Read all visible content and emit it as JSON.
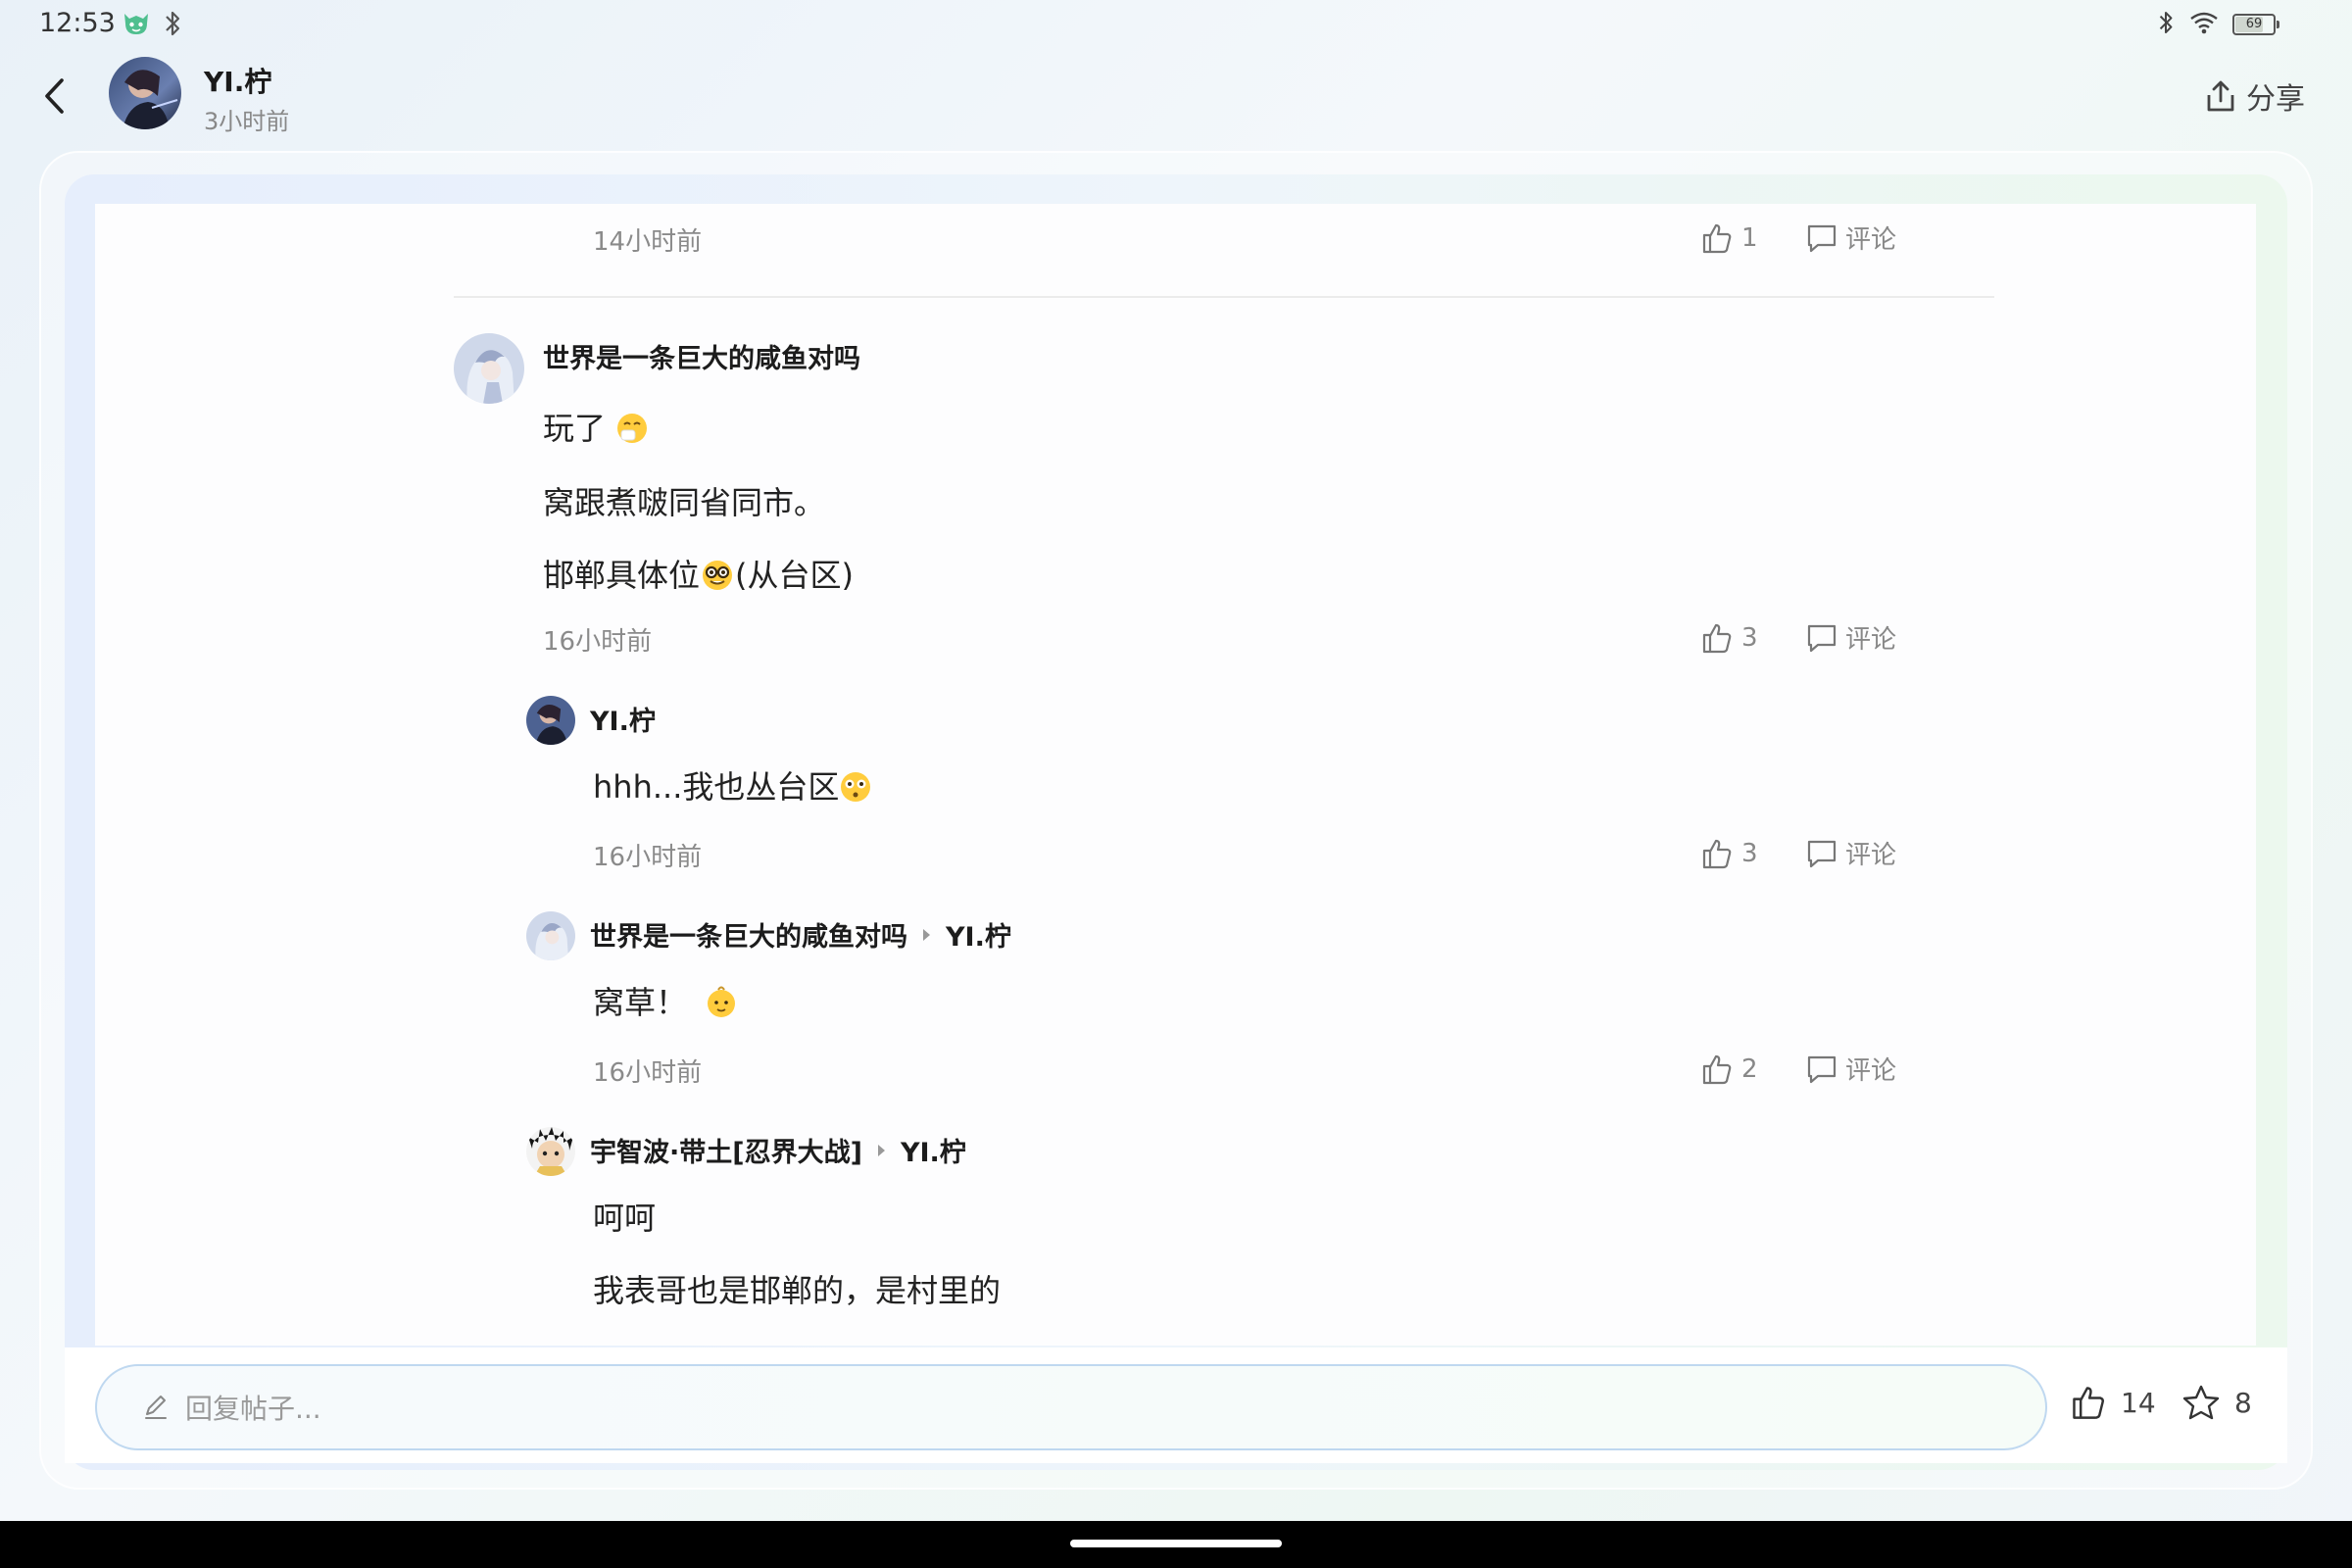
{
  "status_bar": {
    "time": "12:53",
    "battery": "69"
  },
  "header": {
    "author_name": "YI.柠",
    "post_time": "3小时前",
    "share_label": "分享"
  },
  "comments": [
    {
      "time": "14小时前",
      "likes": "1",
      "comment_label": "评论"
    },
    {
      "username": "世界是一条巨大的咸鱼对吗",
      "lines": [
        "玩了",
        "窝跟煮啵同省同市。",
        "邯郸具体位",
        "(从台区)"
      ],
      "time": "16小时前",
      "likes": "3",
      "comment_label": "评论"
    },
    {
      "username": "YI.柠",
      "lines": [
        "hhh...我也丛台区"
      ],
      "time": "16小时前",
      "likes": "3",
      "comment_label": "评论"
    },
    {
      "username": "世界是一条巨大的咸鱼对吗",
      "reply_to": "YI.柠",
      "lines": [
        "窝草！"
      ],
      "time": "16小时前",
      "likes": "2",
      "comment_label": "评论"
    },
    {
      "username": "宇智波·带土[忍界大战]",
      "reply_to": "YI.柠",
      "lines": [
        "呵呵",
        "我表哥也是邯郸的，是村里的"
      ]
    }
  ],
  "bottom_bar": {
    "reply_placeholder": "回复帖子...",
    "likes": "14",
    "favorites": "8"
  },
  "icons": {
    "back": "chevron-left-icon",
    "share": "share-icon",
    "like": "thumbs-up-icon",
    "comment": "comment-bubble-icon",
    "pencil": "pencil-icon",
    "favorite": "star-icon"
  },
  "colors": {
    "accent_border": "#bfd8f0",
    "meta_text": "#8a8a8a"
  }
}
